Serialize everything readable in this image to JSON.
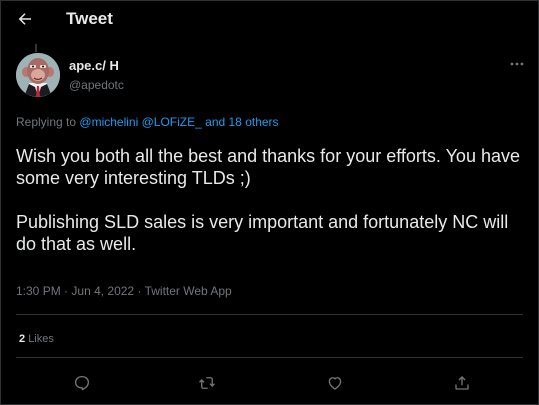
{
  "header": {
    "title": "Tweet",
    "back_icon": "arrow-left-icon"
  },
  "tweet": {
    "author_name": "ape.c/ H",
    "author_handle": "@apedotc",
    "replying_prefix": "Replying to",
    "replying_mentions": [
      "@michelini",
      "@LOFiZE_",
      "and 18 others"
    ],
    "text_paragraphs": [
      "Wish you both all the best and thanks for your efforts. You have some very interesting TLDs ;)",
      "Publishing SLD sales is very important and fortunately NC will do that as well."
    ],
    "time": "1:30 PM",
    "date": "Jun 4, 2022",
    "source": "Twitter Web App",
    "likes_count": "2",
    "likes_label": "Likes"
  },
  "actions": [
    {
      "name": "reply",
      "icon": "comment-icon"
    },
    {
      "name": "retweet",
      "icon": "retweet-icon"
    },
    {
      "name": "like",
      "icon": "heart-icon"
    },
    {
      "name": "share",
      "icon": "share-icon"
    }
  ],
  "colors": {
    "background": "#000000",
    "text": "#e7e9ea",
    "secondary_text": "#71767b",
    "link": "#1d9bf0",
    "border": "#2f3336"
  }
}
